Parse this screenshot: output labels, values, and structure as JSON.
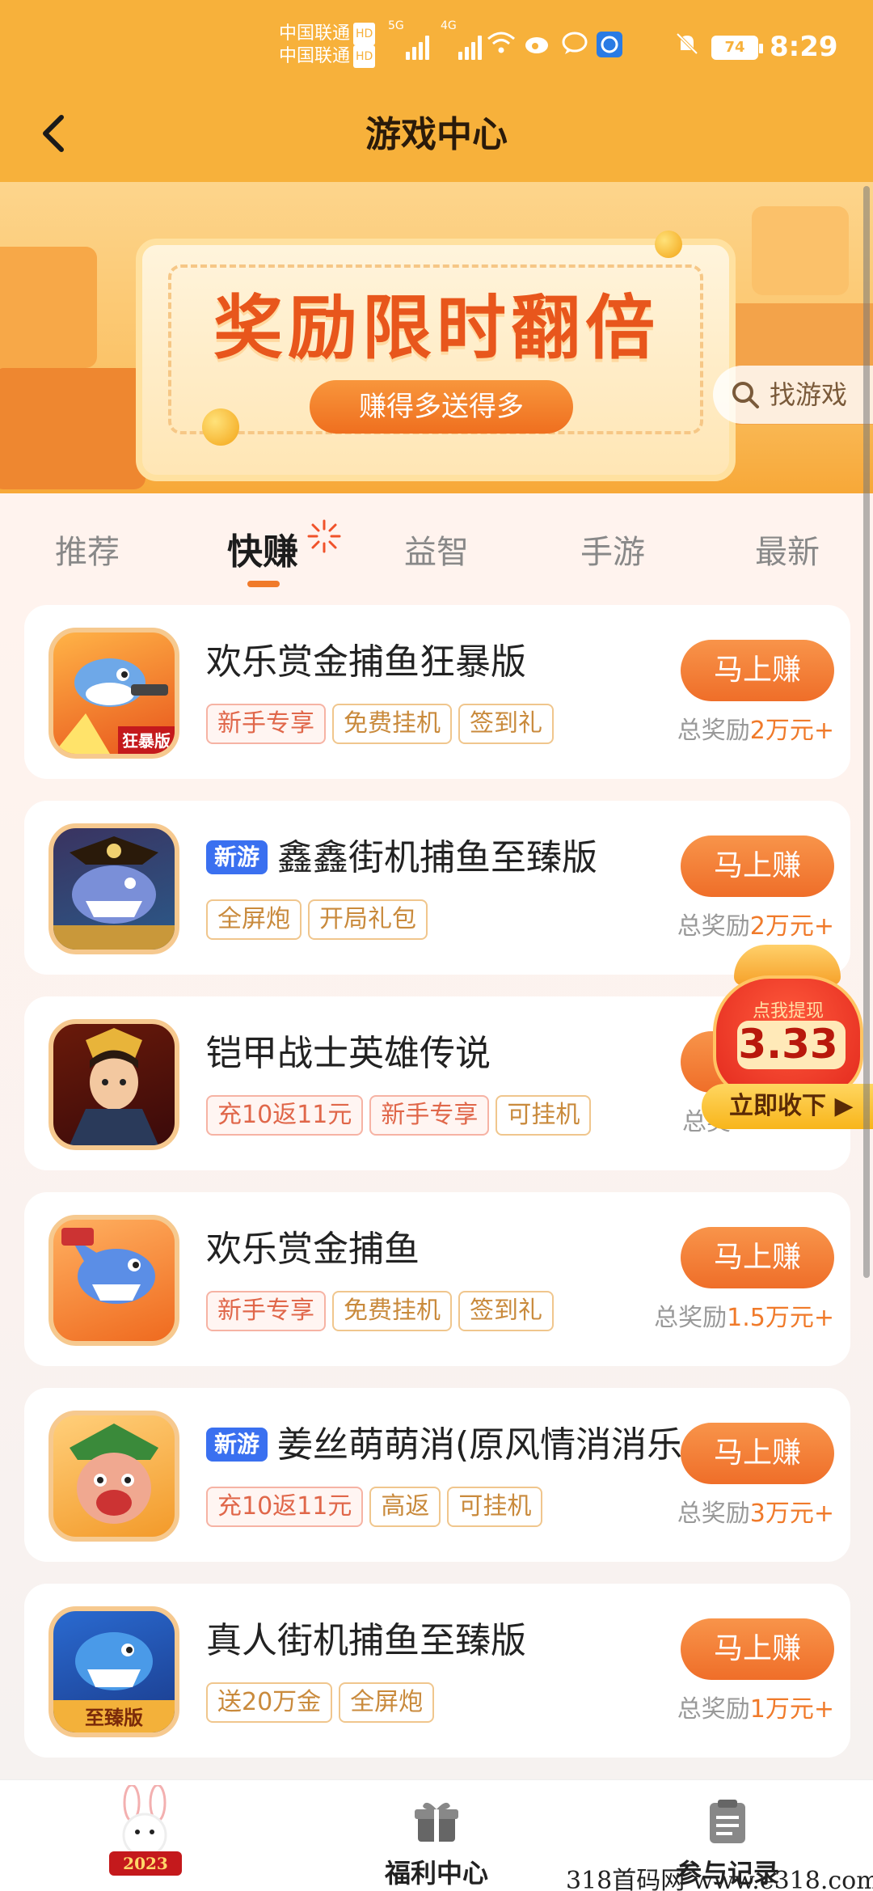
{
  "status_bar": {
    "carrier1": "中国联通",
    "carrier2": "中国联通",
    "hd": "HD",
    "sig1": "5G",
    "sig2": "4G",
    "battery": "74",
    "time": "8:29"
  },
  "header": {
    "title": "游戏中心"
  },
  "banner": {
    "headline": "奖励限时翻倍",
    "pill": "赚得多送得多",
    "search_label": "找游戏"
  },
  "tabs": [
    "推荐",
    "快赚",
    "益智",
    "手游",
    "最新"
  ],
  "active_tab": "快赚",
  "games": [
    {
      "name": "欢乐赏金捕鱼狂暴版",
      "new": false,
      "tags": [
        {
          "t": "新手专享",
          "red": true
        },
        {
          "t": "免费挂机",
          "red": false
        },
        {
          "t": "签到礼",
          "red": false
        }
      ],
      "button": "马上赚",
      "reward_prefix": "总奖励",
      "reward_value": "2万元+",
      "icon": "shark-cannon-icon",
      "icon_badge": "狂暴版"
    },
    {
      "name": "鑫鑫街机捕鱼至臻版",
      "new": true,
      "new_label": "新游",
      "tags": [
        {
          "t": "全屏炮",
          "red": false
        },
        {
          "t": "开局礼包",
          "red": false
        }
      ],
      "button": "马上赚",
      "reward_prefix": "总奖励",
      "reward_value": "2万元+",
      "icon": "pirate-shark-icon"
    },
    {
      "name": "铠甲战士英雄传说",
      "new": false,
      "tags": [
        {
          "t": "充10返11元",
          "red": true
        },
        {
          "t": "新手专享",
          "red": true
        },
        {
          "t": "可挂机",
          "red": false
        }
      ],
      "button": "马上赚",
      "reward_prefix": "总奖",
      "reward_value": "",
      "icon": "warrior-hero-icon"
    },
    {
      "name": "欢乐赏金捕鱼",
      "new": false,
      "tags": [
        {
          "t": "新手专享",
          "red": true
        },
        {
          "t": "免费挂机",
          "red": false
        },
        {
          "t": "签到礼",
          "red": false
        }
      ],
      "button": "马上赚",
      "reward_prefix": "总奖励",
      "reward_value": "1.5万元+",
      "icon": "shark-icon"
    },
    {
      "name": "姜丝萌萌消(原风情消消乐",
      "new": true,
      "new_label": "新游",
      "tags": [
        {
          "t": "充10返11元",
          "red": true
        },
        {
          "t": "高返",
          "red": false
        },
        {
          "t": "可挂机",
          "red": false
        }
      ],
      "button": "马上赚",
      "reward_prefix": "总奖励",
      "reward_value": "3万元+",
      "icon": "general-face-icon"
    },
    {
      "name": "真人街机捕鱼至臻版",
      "new": false,
      "tags": [
        {
          "t": "送20万金",
          "red": false
        },
        {
          "t": "全屏炮",
          "red": false
        }
      ],
      "button": "马上赚",
      "reward_prefix": "总奖励",
      "reward_value": "1万元+",
      "icon": "blue-shark-icon",
      "icon_badge": "至臻版"
    }
  ],
  "floater": {
    "label": "点我提现",
    "amount": "3.33",
    "button": "立即收下"
  },
  "bottom_nav": {
    "year": "2023",
    "welfare": "福利中心",
    "records": "参与记录"
  },
  "watermark": "318首码网 www.e318.com",
  "colors": {
    "header_bg": "#f7b13b",
    "accent": "#ef6e29",
    "new_badge": "#3a70f0"
  }
}
